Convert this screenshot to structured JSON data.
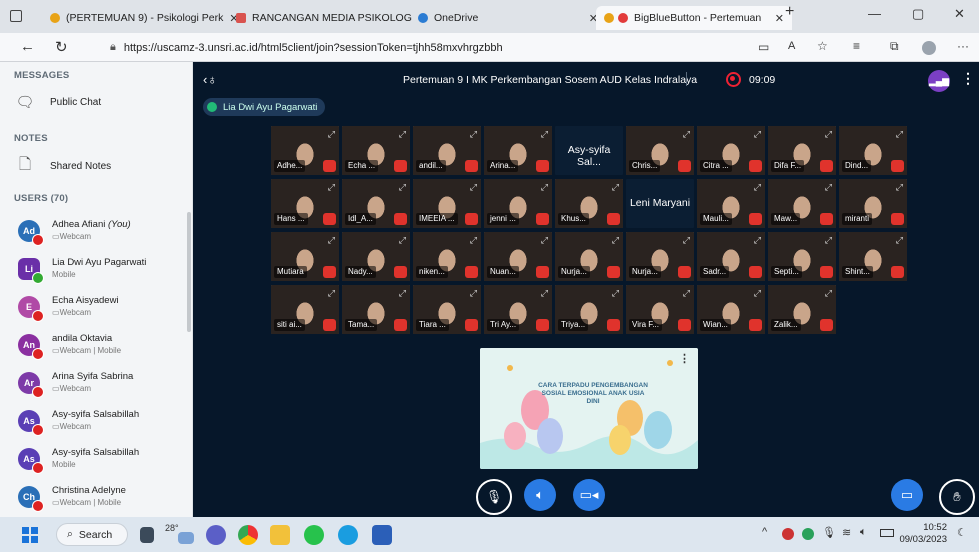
{
  "browser": {
    "tabs": [
      {
        "label": "(PERTEMUAN 9) - Psikologi Perk",
        "color": "#e8a317",
        "active": false
      },
      {
        "label": "RANCANGAN MEDIA PSIKOLOG",
        "color": "#d9534f",
        "active": false
      },
      {
        "label": "OneDrive",
        "color": "#2b7cd3",
        "active": false
      },
      {
        "label": "BigBlueButton - Pertemuan",
        "color": "#e23b3b",
        "active": true
      }
    ],
    "url": "https://uscamz-3.unsri.ac.id/html5client/join?sessionToken=tjhh58mxvhrgzbbh"
  },
  "sidebar": {
    "messages_title": "MESSAGES",
    "public_chat": "Public Chat",
    "notes_title": "NOTES",
    "shared_notes": "Shared Notes",
    "users_title": "USERS (70)",
    "users": [
      {
        "initials": "Ad",
        "name": "Adhea Afiani",
        "you": "(You)",
        "sub": "Webcam",
        "color": "#2a6fb7"
      },
      {
        "initials": "Li",
        "name": "Lia Dwi Ayu Pagarwati",
        "sub": "Mobile",
        "color": "#6a2fa8"
      },
      {
        "initials": "E",
        "name": "Echa Aisyadewi",
        "sub": "Webcam",
        "color": "#b04aa6"
      },
      {
        "initials": "An",
        "name": "andila Oktavia",
        "sub": "Webcam | Mobile",
        "color": "#8a2fa0"
      },
      {
        "initials": "Ar",
        "name": "Arina Syifa Sabrina",
        "sub": "Webcam",
        "color": "#7d3aa8"
      },
      {
        "initials": "As",
        "name": "Asy-syifa Salsabillah",
        "sub": "Webcam",
        "color": "#5a3fb5"
      },
      {
        "initials": "As",
        "name": "Asy-syifa Salsabillah",
        "sub": "Mobile",
        "color": "#5a3fb5"
      },
      {
        "initials": "Ch",
        "name": "Christina Adelyne",
        "sub": "Webcam | Mobile",
        "color": "#2a6fb7"
      }
    ]
  },
  "meeting": {
    "title": "Pertemuan 9 I MK Perkembangan Sosem AUD Kelas Indralaya",
    "timer": "09:09",
    "presenter": "Lia Dwi Ayu Pagarwati",
    "tiles": [
      [
        "Adhe...",
        "Echa ...",
        "andil...",
        "Arina...",
        "Asy-syifa Sal...",
        "Chris...",
        "Citra ...",
        "Difa F...",
        "Dind..."
      ],
      [
        "Hans ...",
        "Idl_A...",
        "IMEEIA ...",
        "jenni ...",
        "Khus...",
        "Leni Maryani",
        "Mauli...",
        "Maw...",
        "miranti"
      ],
      [
        "Mutiara",
        "Nady...",
        "niken...",
        "Nuan...",
        "Nurja...",
        "Nurja...",
        "Sadr...",
        "Septi...",
        "Shint..."
      ],
      [
        "siti ai...",
        "Tama...",
        "Tiara ...",
        "Tri Ay...",
        "Triya...",
        "Vira F...",
        "Wian...",
        "Zalik..."
      ]
    ],
    "slide_text": "CARA TERPADU PENGEMBANGAN SOSIAL EMOSIONAL ANAK USIA DINI"
  },
  "taskbar": {
    "search": "Search",
    "weather": "28°",
    "time": "10:52",
    "date": "09/03/2023"
  }
}
